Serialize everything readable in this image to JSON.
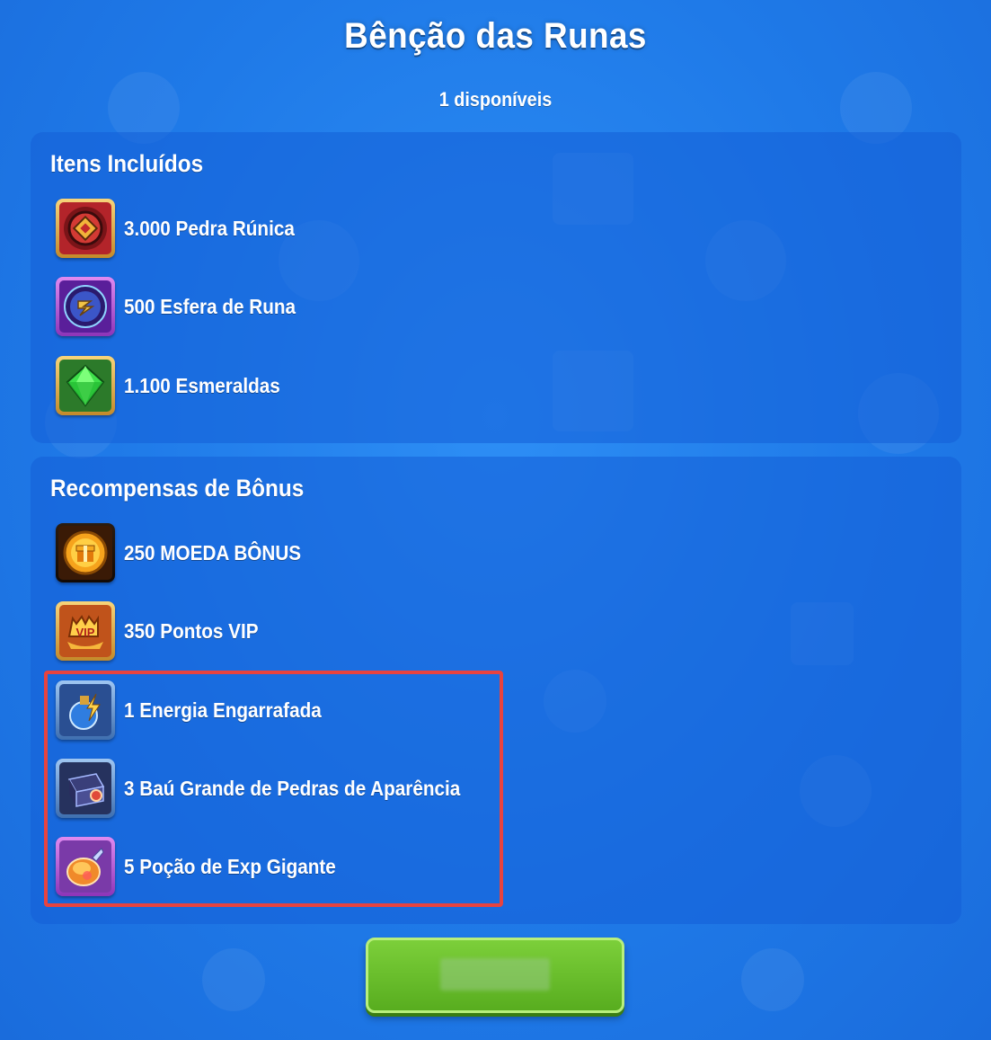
{
  "header": {
    "title": "Bênção das Runas",
    "availability": "1 disponíveis"
  },
  "included": {
    "title": "Itens Incluídos",
    "items": [
      {
        "label": "3.000 Pedra Rúnica",
        "icon": "rune-stone-icon"
      },
      {
        "label": "500 Esfera de Runa",
        "icon": "rune-sphere-icon"
      },
      {
        "label": "1.100 Esmeraldas",
        "icon": "emerald-icon"
      }
    ]
  },
  "bonus": {
    "title": "Recompensas de Bônus",
    "items": [
      {
        "label": "250 MOEDA BÔNUS",
        "icon": "bonus-coin-icon"
      },
      {
        "label": "350 Pontos VIP",
        "icon": "vip-points-icon"
      },
      {
        "label": "1 Energia Engarrafada",
        "icon": "bottled-energy-icon"
      },
      {
        "label": "3 Baú Grande de Pedras de Aparência",
        "icon": "appearance-chest-icon"
      },
      {
        "label": "5 Poção de Exp Gigante",
        "icon": "exp-potion-icon"
      }
    ]
  },
  "confirm_button": {
    "label": ""
  },
  "colors": {
    "background": "#1f7ae8",
    "panel": "#1d5fd6",
    "highlight": "#e8433f",
    "button": "#6cc12e"
  }
}
